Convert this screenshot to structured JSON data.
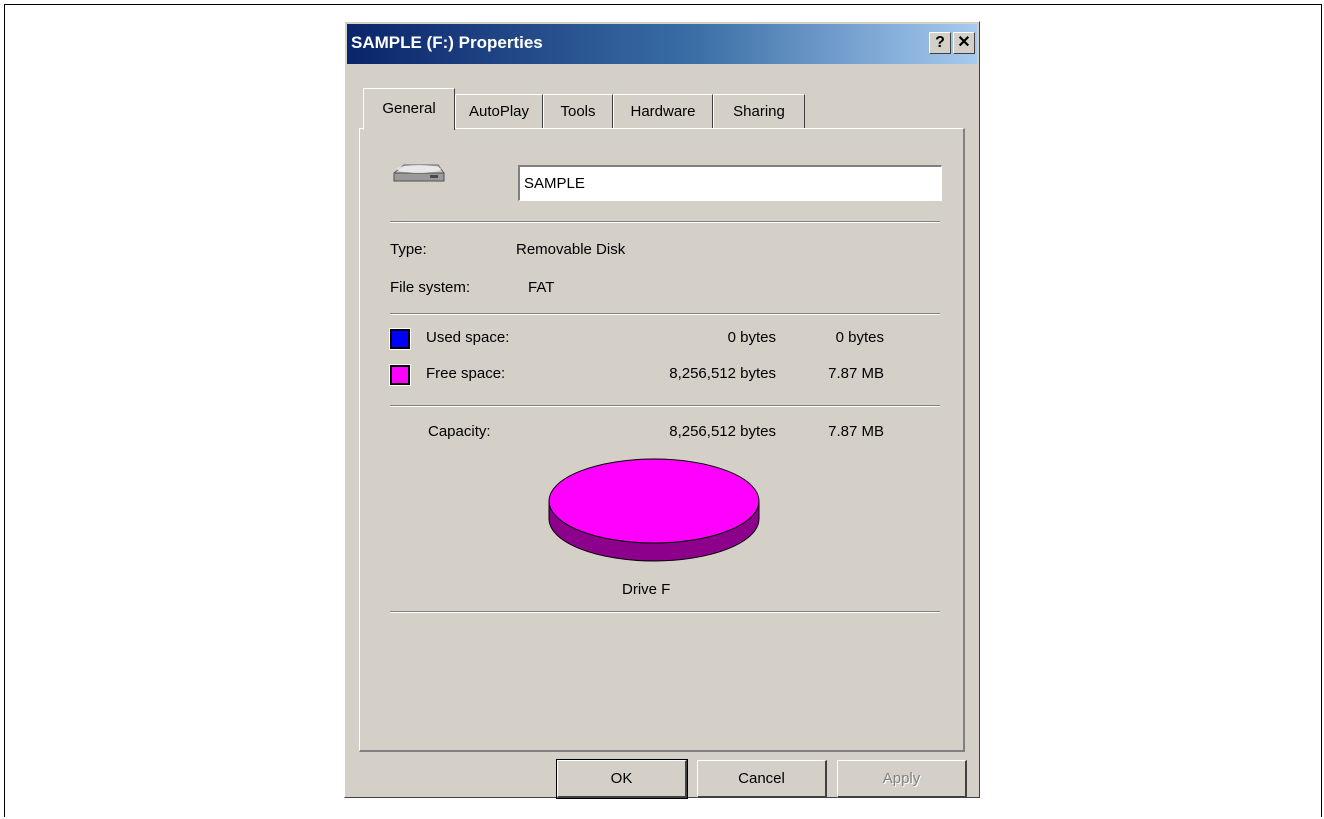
{
  "window": {
    "title": "SAMPLE (F:) Properties",
    "help_button": "?",
    "close_button": "✕"
  },
  "tabs": [
    {
      "label": "General",
      "active": true
    },
    {
      "label": "AutoPlay",
      "active": false
    },
    {
      "label": "Tools",
      "active": false
    },
    {
      "label": "Hardware",
      "active": false
    },
    {
      "label": "Sharing",
      "active": false
    }
  ],
  "general": {
    "drive_icon": "removable-drive-icon",
    "volume_label": "SAMPLE",
    "type_label": "Type:",
    "type_value": "Removable Disk",
    "fs_label": "File system:",
    "fs_value": "FAT",
    "used": {
      "label": "Used space:",
      "bytes": "0 bytes",
      "size": "0 bytes",
      "color": "#0000ff"
    },
    "free": {
      "label": "Free space:",
      "bytes": "8,256,512 bytes",
      "size": "7.87 MB",
      "color": "#ff00ff"
    },
    "capacity": {
      "label": "Capacity:",
      "bytes": "8,256,512 bytes",
      "size": "7.87 MB"
    },
    "drive_caption": "Drive F"
  },
  "chart_data": {
    "type": "pie",
    "categories": [
      "Used space",
      "Free space"
    ],
    "values": [
      0,
      8256512
    ],
    "colors": [
      "#0000ff",
      "#ff00ff"
    ],
    "title": "Drive F"
  },
  "buttons": {
    "ok": "OK",
    "cancel": "Cancel",
    "apply": "Apply"
  }
}
